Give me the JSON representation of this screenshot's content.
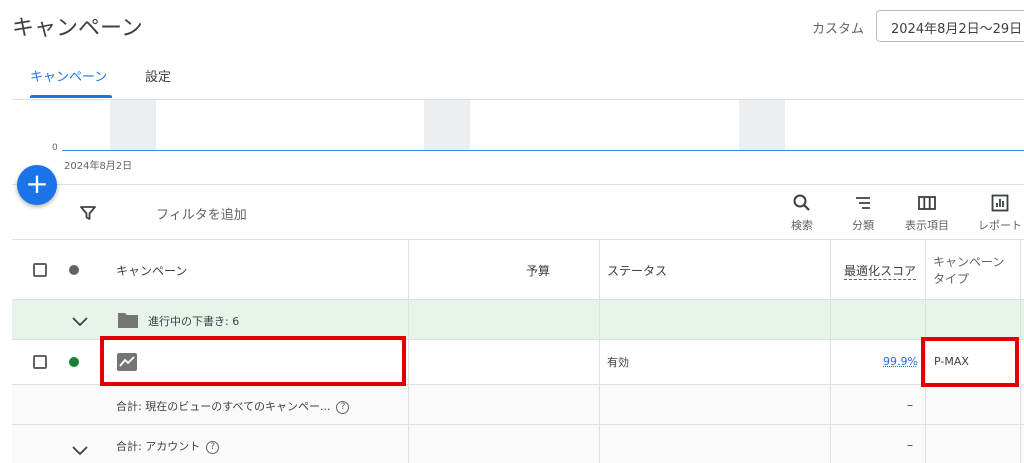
{
  "header": {
    "title": "キャンペーン",
    "date_label": "カスタム",
    "date_range": "2024年8月2日〜29日"
  },
  "tabs": [
    {
      "label": "キャンペーン",
      "active": true
    },
    {
      "label": "設定",
      "active": false
    }
  ],
  "chart": {
    "y_zero_label": "0",
    "start_date": "2024年8月2日"
  },
  "fab": {
    "label": "+"
  },
  "toolbar": {
    "filter_placeholder": "フィルタを追加",
    "search_label": "検索",
    "segment_label": "分類",
    "columns_label": "表示項目",
    "reports_label": "レポート"
  },
  "table": {
    "headers": {
      "campaign": "キャンペーン",
      "budget": "予算",
      "status": "ステータス",
      "optimization_score": "最適化スコア",
      "campaign_type_line1": "キャンペーン",
      "campaign_type_line2": "タイプ"
    },
    "group_row": {
      "label": "進行中の下書き: 6"
    },
    "campaign_row": {
      "status": "有効",
      "optimization_score": "99.9%",
      "campaign_type": "P-MAX"
    },
    "total_row": {
      "label": "合計: 現在のビューのすべてのキャンペー...",
      "value": "–"
    },
    "account_row": {
      "label": "合計: アカウント",
      "value": "–"
    }
  },
  "colors": {
    "accent": "#1a73e8",
    "status_enabled": "#188038",
    "highlight_box": "#e00000",
    "group_row_bg": "#e6f4ea"
  }
}
